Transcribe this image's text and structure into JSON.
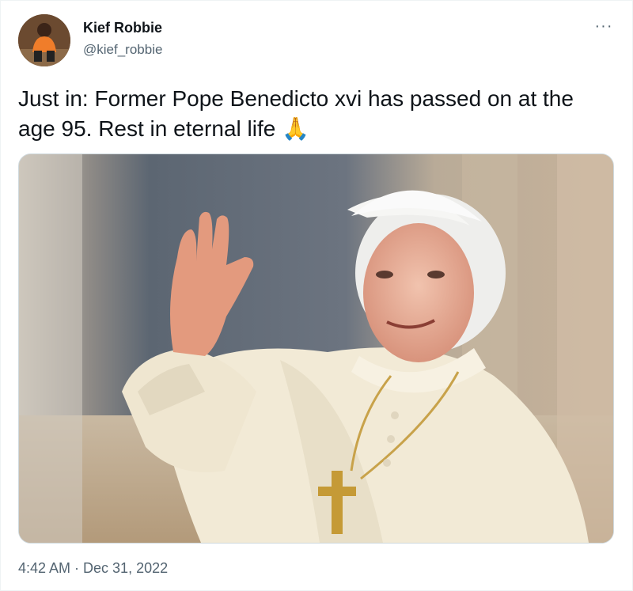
{
  "author": {
    "name": "Kief Robbie",
    "handle": "@kief_robbie"
  },
  "menu": {
    "more_label": "···"
  },
  "tweet": {
    "text": "Just in: Former Pope Benedicto xvi has passed on at the age 95. Rest in eternal life 🙏"
  },
  "meta": {
    "timestamp": "4:42 AM · Dec 31, 2022"
  },
  "icons": {
    "more": "more-icon",
    "avatar": "avatar-image"
  }
}
